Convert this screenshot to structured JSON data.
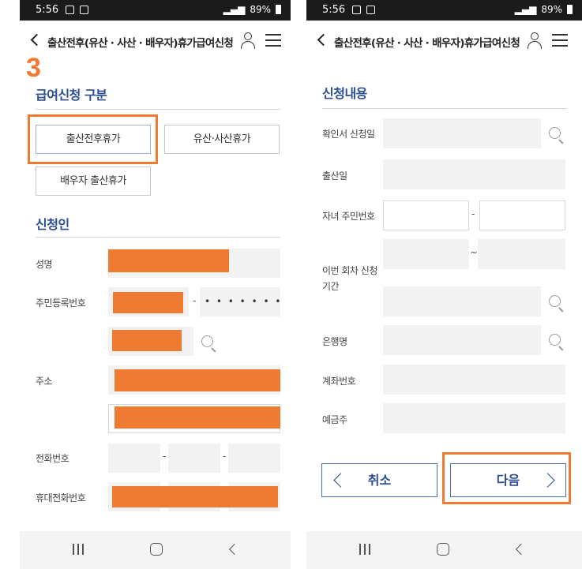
{
  "status_bar": {
    "time": "5:56",
    "battery": "89%"
  },
  "app_bar": {
    "title": "출산전후(유산 · 사산 · 배우자)휴가급여신청"
  },
  "left_screen": {
    "step_marker": "3",
    "leave_type_section": {
      "title": "급여신청 구분",
      "options": [
        "출산전후휴가",
        "유산·사산휴가",
        "배우자 출산휴가"
      ],
      "selected": "출산전후휴가"
    },
    "applicant_section": {
      "title": "신청인",
      "name_label": "성명",
      "rrn_label": "주민등록번호",
      "rrn_masked": "• • • • • • •",
      "address_label": "주소",
      "phone_label": "전화번호",
      "mobile_label": "휴대전화번호",
      "separator": "-"
    }
  },
  "right_screen": {
    "application_section": {
      "title": "신청내용",
      "confirm_date_label": "확인서 신청일",
      "birth_date_label": "출산일",
      "child_rrn_label": "자녀 주민번호",
      "period_label": "이번 회차 신청기간",
      "period_separator": "~",
      "bank_label": "은행명",
      "account_label": "계좌번호",
      "holder_label": "예금주",
      "separator": "-"
    },
    "actions": {
      "cancel_label": "취소",
      "next_label": "다음"
    }
  },
  "colors": {
    "accent": "#2b4d94",
    "highlight": "#ef7b32",
    "field_bg": "#f2f2f2"
  },
  "icons": [
    "back-arrow-icon",
    "user-icon",
    "menu-icon",
    "search-icon",
    "recent-apps-icon",
    "home-icon",
    "back-nav-icon"
  ]
}
